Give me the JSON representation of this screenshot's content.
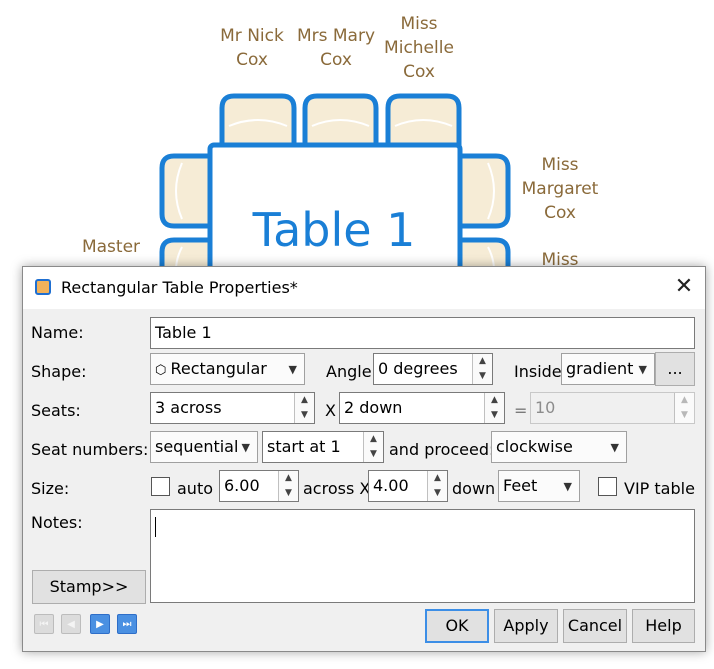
{
  "canvas": {
    "table_label": "Table 1",
    "guests": {
      "top_1": [
        "Mr Nick",
        "Cox"
      ],
      "top_2": [
        "Mrs Mary",
        "Cox"
      ],
      "top_3": [
        "Miss",
        "Michelle",
        "Cox"
      ],
      "right_1": [
        "Miss",
        "Margaret",
        "Cox"
      ],
      "right_2": [
        "Miss"
      ],
      "left_1": [
        "Master"
      ]
    },
    "colors": {
      "table_stroke": "#1a7fd6",
      "chair_fill": "#f6ecd6",
      "guest_text": "#8a6a3a"
    }
  },
  "dialog": {
    "title": "Rectangular Table Properties*",
    "close_icon": "close-icon",
    "name_label": "Name:",
    "name_value": "Table 1",
    "shape_label": "Shape:",
    "shape_value": "Rectangular",
    "angle_label": "Angle:",
    "angle_value": "0 degrees",
    "inside_label": "Inside:",
    "inside_value": "gradient",
    "ellipsis_label": "...",
    "seats_label": "Seats:",
    "across_value": "3 across",
    "x_label": "X",
    "down_value": "2 down",
    "equals_label": "=",
    "total_value": "10",
    "seat_numbers_label": "Seat numbers:",
    "numbering_value": "sequential",
    "start_value": "start at 1",
    "proceed_label": "and proceed:",
    "direction_value": "clockwise",
    "size_label": "Size:",
    "auto_label": "auto",
    "width_value": "6.00",
    "across_x_label": "across X",
    "height_value": "4.00",
    "down_label": "down",
    "unit_value": "Feet",
    "vip_label": "VIP table",
    "notes_label": "Notes:",
    "notes_value": "",
    "stamp_label": "Stamp>>",
    "ok_label": "OK",
    "apply_label": "Apply",
    "cancel_label": "Cancel",
    "help_label": "Help"
  }
}
